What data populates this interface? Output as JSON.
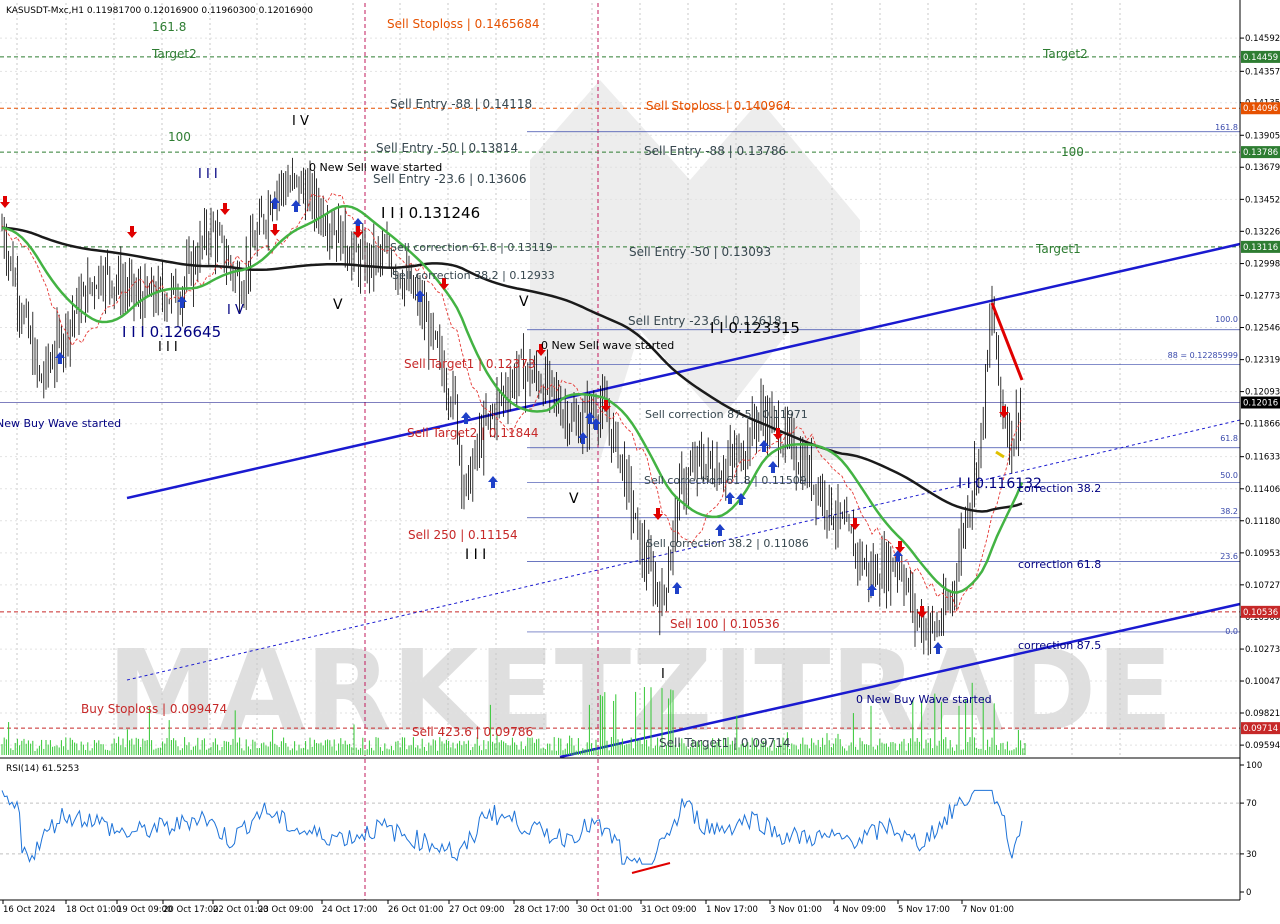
{
  "chart_data": {
    "type": "candlestick",
    "symbol_line": "KASUSDT-Mxc,H1  0.11981700 0.12016900 0.11960300 0.12016900",
    "watermark": "MARKETZITRADE",
    "price_range": [
      0.0951,
      0.1484
    ],
    "price_ticks": [
      "0.14592",
      "0.14357",
      "0.14135",
      "0.13905",
      "0.13679",
      "0.13452",
      "0.13226",
      "0.12998",
      "0.12773",
      "0.12546",
      "0.12319",
      "0.12093",
      "0.11866",
      "0.11633",
      "0.11406",
      "0.11180",
      "0.10953",
      "0.10727",
      "0.10500",
      "0.10273",
      "0.10047",
      "0.09821",
      "0.09594"
    ],
    "time_ticks": [
      "16 Oct 2024",
      "18 Oct 01:00",
      "19 Oct 09:00",
      "20 Oct 17:00",
      "22 Oct 01:00",
      "23 Oct 09:00",
      "24 Oct 17:00",
      "26 Oct 01:00",
      "27 Oct 09:00",
      "28 Oct 17:00",
      "30 Oct 01:00",
      "31 Oct 09:00",
      "1 Nov 17:00",
      "3 Nov 01:00",
      "4 Nov 09:00",
      "5 Nov 17:00",
      "7 Nov 01:00"
    ],
    "price_badges": [
      {
        "value": "0.14459",
        "price": 0.14459,
        "color": "#2e7d32"
      },
      {
        "value": "0.14096",
        "price": 0.14096,
        "color": "#e65100"
      },
      {
        "value": "0.13786",
        "price": 0.13786,
        "color": "#2e7d32"
      },
      {
        "value": "0.13116",
        "price": 0.13116,
        "color": "#2e7d32"
      },
      {
        "value": "0.12016",
        "price": 0.12016,
        "color": "#000000"
      },
      {
        "value": "0.10536",
        "price": 0.10536,
        "color": "#c62828"
      },
      {
        "value": "0.09714",
        "price": 0.09714,
        "color": "#c62828"
      }
    ],
    "labels": [
      {
        "text": "161.8",
        "color": "#2e7d32"
      },
      {
        "text": "Target2",
        "color": "#2e7d32"
      },
      {
        "text": "Sell Stoploss | 0.1465684",
        "color": "#e65100"
      },
      {
        "text": "Target2",
        "color": "#2e7d32"
      },
      {
        "text": "Sell Entry -88 | 0.14118",
        "color": "#37474f"
      },
      {
        "text": "Sell Stoploss | 0.140964",
        "color": "#e65100"
      },
      {
        "text": "100",
        "color": "#2e7d32"
      },
      {
        "text": "Sell Entry -50 | 0.13814",
        "color": "#37474f"
      },
      {
        "text": "Sell Entry -88 | 0.13786",
        "color": "#37474f"
      },
      {
        "text": "100",
        "color": "#2e7d32"
      },
      {
        "text": "Sell Entry -23.6 | 0.13606",
        "color": "#37474f"
      },
      {
        "text": "0 New Sell wave started",
        "color": "#000000"
      },
      {
        "text": "I V",
        "color": "#000000"
      },
      {
        "text": "I I I",
        "color": "#000080"
      },
      {
        "text": "I I I 0.131246",
        "color": "#000000"
      },
      {
        "text": "Sell correction 61.8 | 0.13119",
        "color": "#37474f"
      },
      {
        "text": "Target1",
        "color": "#2e7d32"
      },
      {
        "text": "Sell Entry -50 | 0.13093",
        "color": "#37474f"
      },
      {
        "text": "Sell correction 38.2 | 0.12933",
        "color": "#37474f"
      },
      {
        "text": "V",
        "color": "#000000"
      },
      {
        "text": "V",
        "color": "#000000"
      },
      {
        "text": "I V",
        "color": "#000080"
      },
      {
        "text": "I I I 0.126645",
        "color": "#000080"
      },
      {
        "text": "I I I",
        "color": "#000000"
      },
      {
        "text": "Sell Entry -23.6 | 0.12618",
        "color": "#37474f"
      },
      {
        "text": "I I 0.123315",
        "color": "#000000"
      },
      {
        "text": "0 New Sell wave started",
        "color": "#000000"
      },
      {
        "text": "Sell Target1 | 0.12373",
        "color": "#c62828"
      },
      {
        "text": "New Buy Wave started",
        "color": "#000080"
      },
      {
        "text": "Sell correction 87.5 | 0.11971",
        "color": "#37474f"
      },
      {
        "text": "Sell Target2 | 0.11844",
        "color": "#c62828"
      },
      {
        "text": "Sell correction 61.8 | 0.11509",
        "color": "#37474f"
      },
      {
        "text": "I I 0.116132",
        "color": "#000080"
      },
      {
        "text": "correction 38.2",
        "color": "#000080"
      },
      {
        "text": "V",
        "color": "#000000"
      },
      {
        "text": "Sell 250 | 0.11154",
        "color": "#c62828"
      },
      {
        "text": "I I I",
        "color": "#000000"
      },
      {
        "text": "Sell correction 38.2 | 0.11086",
        "color": "#37474f"
      },
      {
        "text": "correction 61.8",
        "color": "#000080"
      },
      {
        "text": "Sell 100 | 0.10536",
        "color": "#c62828"
      },
      {
        "text": "correction 87.5",
        "color": "#000080"
      },
      {
        "text": "0 New Buy Wave started",
        "color": "#000080"
      },
      {
        "text": "Buy Stoploss | 0.099474",
        "color": "#c62828"
      },
      {
        "text": "Sell 423.6 | 0.09786",
        "color": "#c62828"
      },
      {
        "text": "Sell Target1 | 0.09714",
        "color": "#37474f"
      },
      {
        "text": "I",
        "color": "#000000"
      }
    ],
    "fib_labels": [
      "161.8",
      "100.0",
      "88 = 0.12285999",
      "61.8",
      "50.0",
      "38.2",
      "23.6",
      "0.0"
    ],
    "rsi": {
      "label": "RSI(14) 61.5253",
      "ticks": [
        "100",
        "70",
        "30",
        "0"
      ],
      "range": [
        0,
        100
      ]
    }
  }
}
